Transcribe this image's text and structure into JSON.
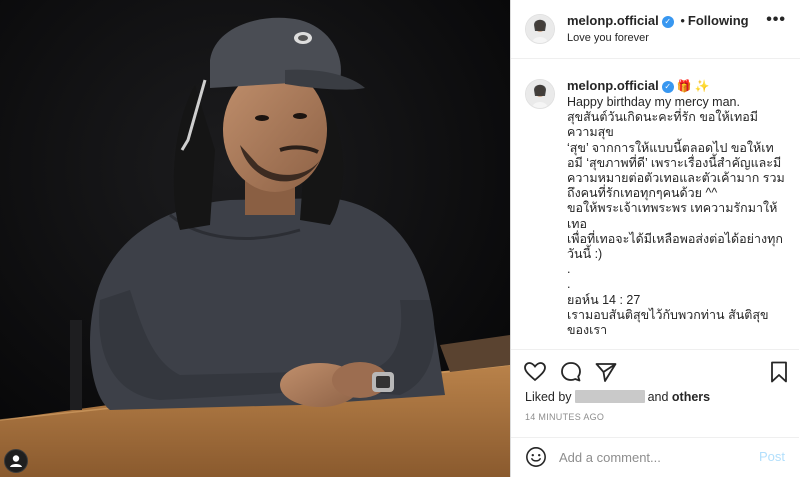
{
  "post": {
    "username": "melonp.official",
    "follow_status": "Following",
    "location": "Love you forever"
  },
  "caption": {
    "username": "melonp.official",
    "text": "Happy birthday my mercy man.\nสุขสันต์วันเกิดนะคะที่รัก ขอให้เทอมีความสุข\n‘สุข’ จากการให้แบบนี้ตลอดไป ขอให้เทอมี ‘สุขภาพที่ดี’ เพราะเรื่องนี้สำคัญและมีความหมายต่อตัวเทอและตัวเค้ามาก รวมถึงคนที่รักเทอทุกๆคนด้วย ^^\nขอให้พระเจ้าเทพระพร เทความรักมาให้เทอ\nเพื่อที่เทอจะได้มีเหลือพอส่งต่อได้อย่างทุกวันนี้ :)\n.\n.\nยอห์น 14 : 27\nเรามอบสันติสุขไว้กับพวกท่าน สันติสุขของเรา"
  },
  "likes": {
    "prefix": "Liked by",
    "and": "and",
    "others": "others"
  },
  "timestamp": "14 MINUTES AGO",
  "comment": {
    "placeholder": "Add a comment...",
    "post_label": "Post"
  },
  "icons": {
    "verified": "✓",
    "more": "•••",
    "follow_separator": "•",
    "gift": "🎁",
    "sparkle": "✨"
  },
  "colors": {
    "accent": "#3897f0",
    "post_disabled": "#b2dffc",
    "muted": "#8e8e8e"
  }
}
